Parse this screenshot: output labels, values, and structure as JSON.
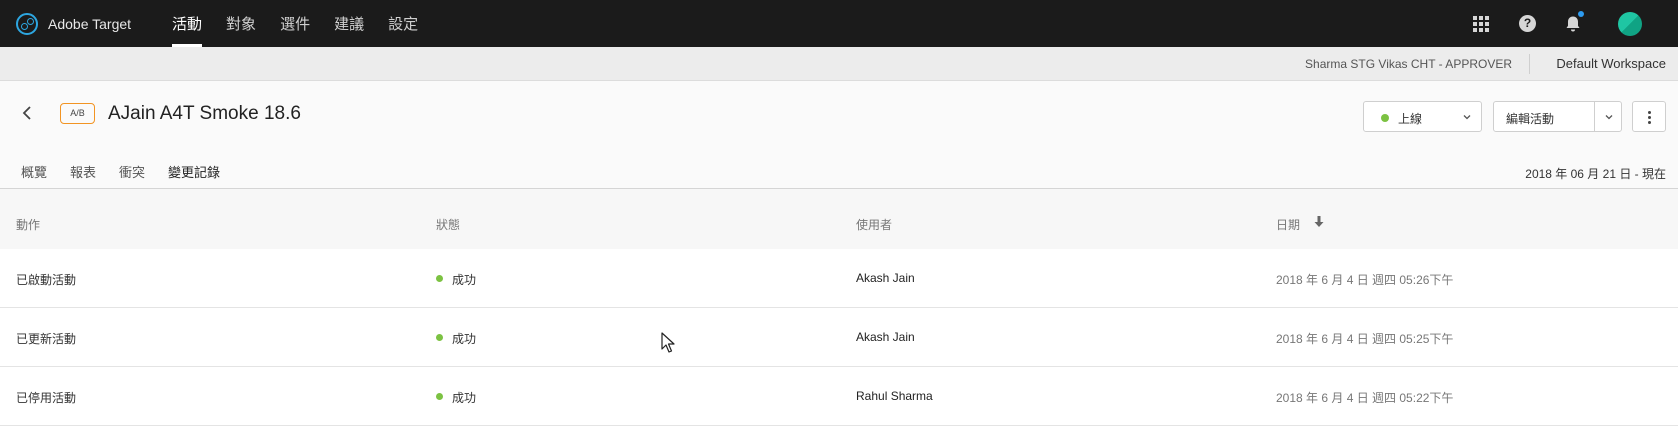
{
  "app": {
    "name": "Adobe Target"
  },
  "nav": {
    "items": [
      {
        "label": "活動",
        "active": true
      },
      {
        "label": "對象",
        "active": false
      },
      {
        "label": "選件",
        "active": false
      },
      {
        "label": "建議",
        "active": false
      },
      {
        "label": "設定",
        "active": false
      }
    ],
    "icons": [
      "apps-grid-icon",
      "help-icon",
      "notifications-icon",
      "avatar"
    ]
  },
  "subheader": {
    "user_role": "Sharma STG Vikas CHT - APPROVER",
    "workspace": "Default Workspace"
  },
  "activity": {
    "type_badge": "A/B",
    "title": "AJain A4T Smoke 18.6",
    "status_label": "上線",
    "edit_label": "編輯活動"
  },
  "tabs": [
    {
      "label": "概覽",
      "active": false
    },
    {
      "label": "報表",
      "active": false
    },
    {
      "label": "衝突",
      "active": false
    },
    {
      "label": "變更記錄",
      "active": true
    }
  ],
  "date_range": "2018 年 06 月 21 日 - 現在",
  "table": {
    "columns": [
      "動作",
      "狀態",
      "使用者",
      "日期"
    ],
    "rows": [
      {
        "action": "已啟動活動",
        "status": "成功",
        "user": "Akash Jain",
        "date": "2018 年 6 月 4 日 週四 05:26下午"
      },
      {
        "action": "已更新活動",
        "status": "成功",
        "user": "Akash Jain",
        "date": "2018 年 6 月 4 日 週四 05:25下午"
      },
      {
        "action": "已停用活動",
        "status": "成功",
        "user": "Rahul Sharma",
        "date": "2018 年 6 月 4 日 週四 05:22下午"
      }
    ]
  },
  "colors": {
    "nav_bg": "#1b1b1b",
    "accent_logo": "#2da6e0",
    "badge_border": "#f29423",
    "status_green": "#7cc242",
    "notification_dot": "#2d9bf0"
  }
}
